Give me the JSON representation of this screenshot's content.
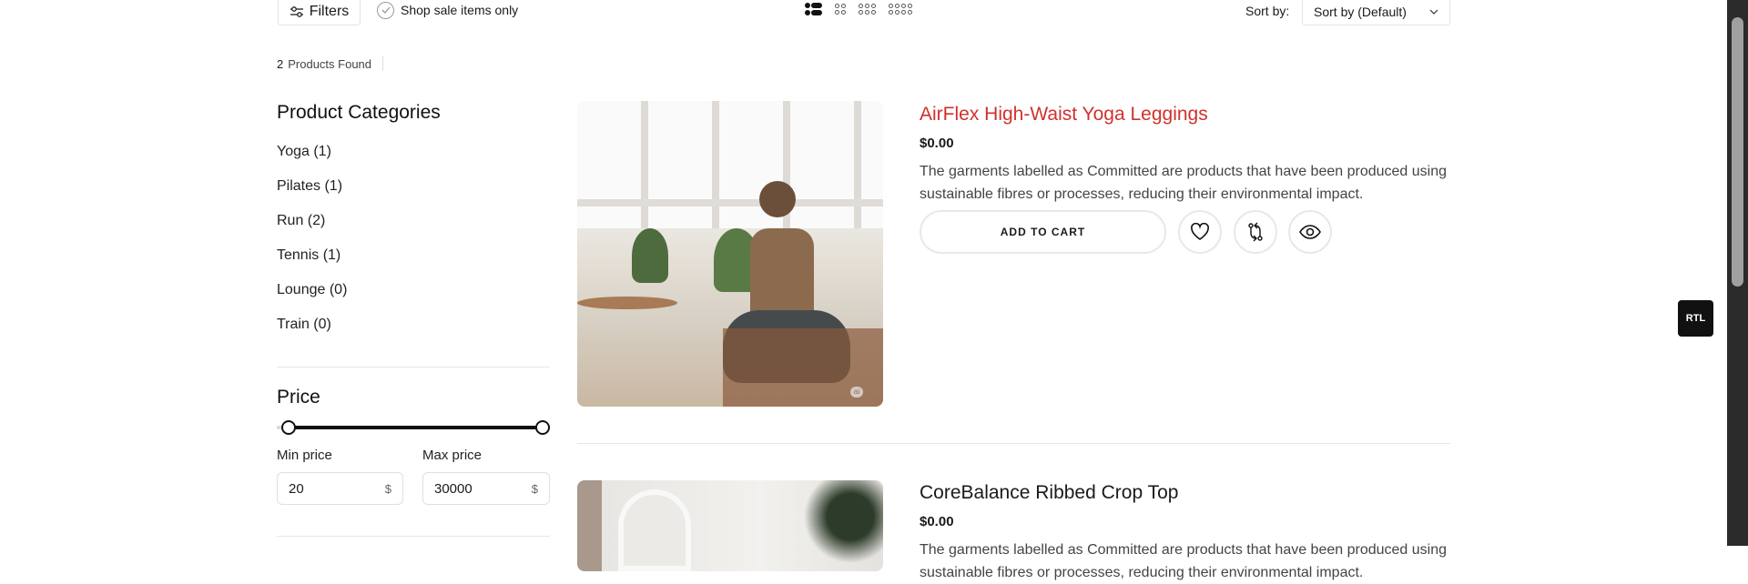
{
  "toolbar": {
    "filters_label": "Filters",
    "sale_label": "Shop sale items only",
    "views": [
      "list-view-icon",
      "grid-2-icon",
      "grid-3-icon",
      "grid-4-icon"
    ],
    "sort_label": "Sort by:",
    "sort_value": "Sort by (Default)"
  },
  "results": {
    "count": "2",
    "label": "Products Found"
  },
  "sidebar": {
    "categories_title": "Product Categories",
    "categories": [
      {
        "label": "Yoga (1)"
      },
      {
        "label": "Pilates (1)"
      },
      {
        "label": "Run (2)"
      },
      {
        "label": "Tennis (1)"
      },
      {
        "label": "Lounge (0)"
      },
      {
        "label": "Train (0)"
      }
    ],
    "price_title": "Price",
    "min_label": "Min price",
    "max_label": "Max price",
    "min_value": "20",
    "max_value": "30000",
    "currency": "$"
  },
  "products": [
    {
      "title": "AirFlex High-Waist Yoga Leggings",
      "price": "$0.00",
      "desc": "The garments labelled as Committed are products that have been produced using sustainable fibres or processes, reducing their environmental impact.",
      "cart_label": "ADD TO CART",
      "title_color": "#d0312d"
    },
    {
      "title": "CoreBalance Ribbed Crop Top",
      "price": "$0.00",
      "desc": "The garments labelled as Committed are products that have been produced using sustainable fibres or processes, reducing their environmental impact."
    }
  ],
  "rtl_label": "RTL",
  "image_badge": "ai"
}
